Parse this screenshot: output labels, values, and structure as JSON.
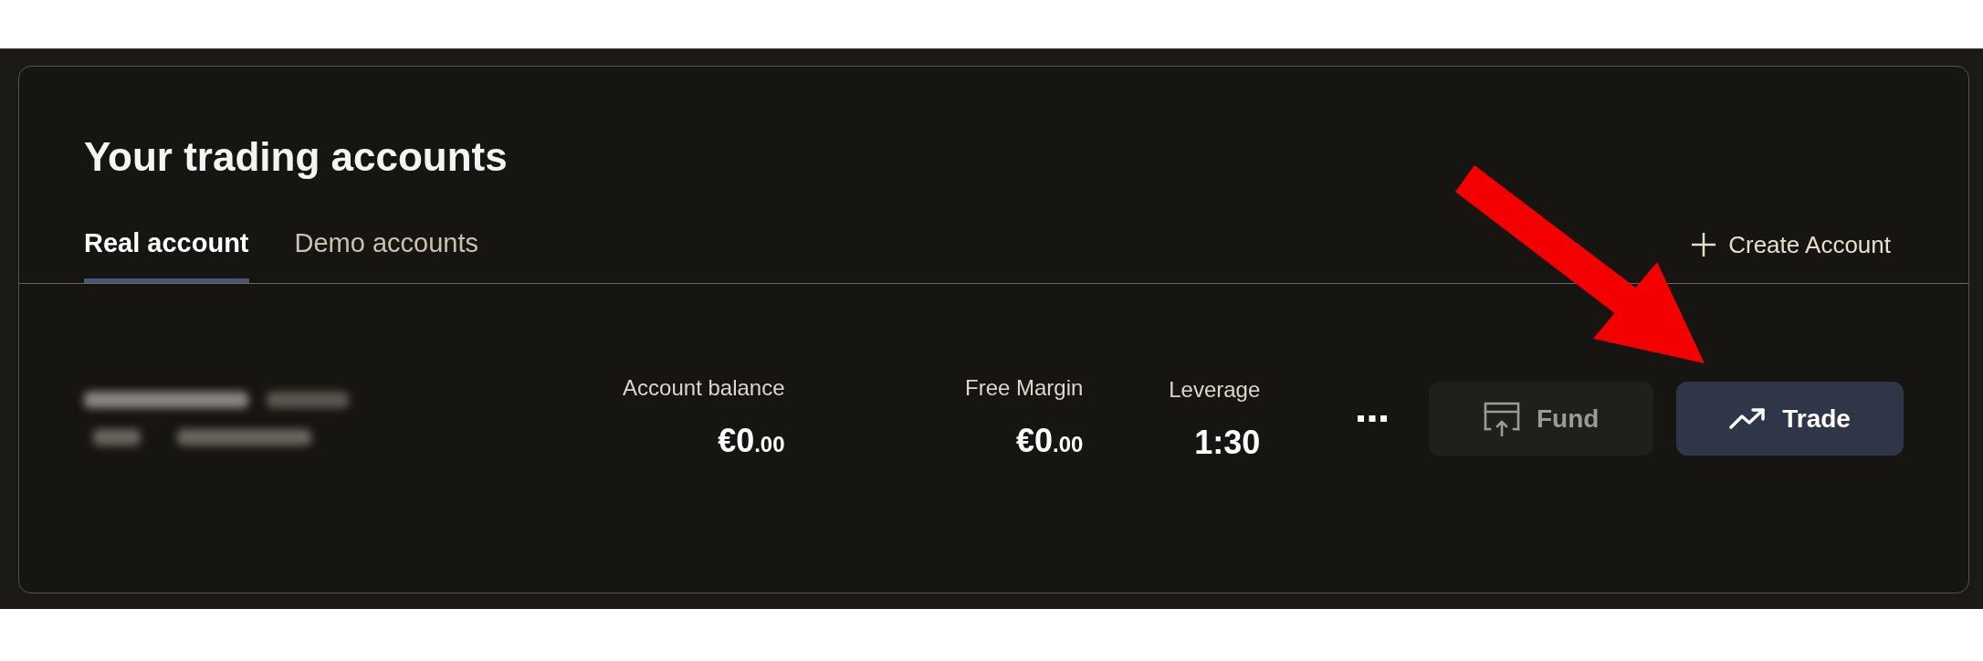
{
  "title": "Your trading accounts",
  "tabs": [
    {
      "label": "Real account",
      "selected": true
    },
    {
      "label": "Demo accounts",
      "selected": false
    }
  ],
  "create_account": {
    "label": "Create Account"
  },
  "account": {
    "stats": [
      {
        "label": "Account balance",
        "value": "€0",
        "fraction": ".00"
      },
      {
        "label": "Free Margin",
        "value": "€0",
        "fraction": ".00"
      },
      {
        "label": "Leverage",
        "value": "1:30"
      }
    ],
    "actions": [
      {
        "label": "Fund",
        "kind": "secondary"
      },
      {
        "label": "Trade",
        "kind": "primary"
      }
    ]
  }
}
